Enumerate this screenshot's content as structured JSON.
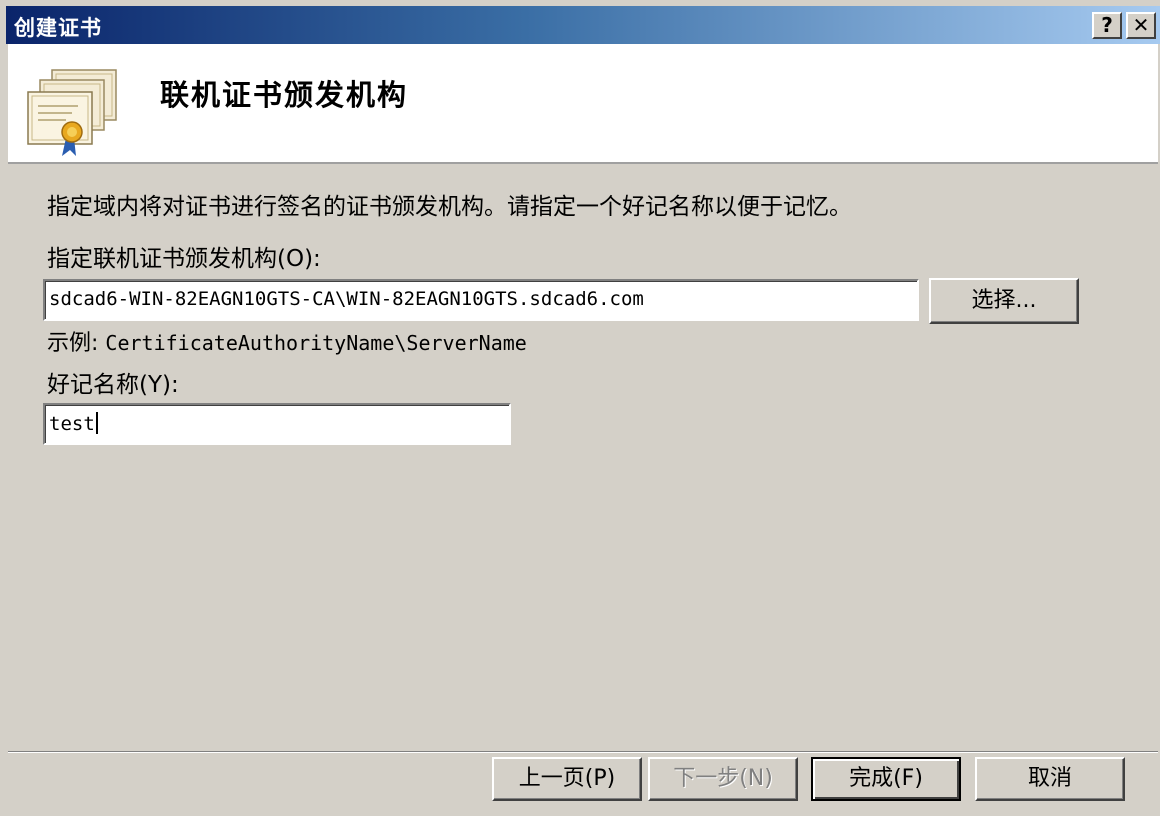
{
  "window": {
    "title": "创建证书",
    "help_label": "?",
    "close_label": "✕"
  },
  "header": {
    "title": "联机证书颁发机构",
    "icon": "certificate-icon"
  },
  "body": {
    "description": "指定域内将对证书进行签名的证书颁发机构。请指定一个好记名称以便于记忆。",
    "ca_label": "指定联机证书颁发机构(O):",
    "ca_value": "sdcad6-WIN-82EAGN10GTS-CA\\WIN-82EAGN10GTS.sdcad6.com",
    "select_label": "选择...",
    "example_prefix": "示例: ",
    "example_value": "CertificateAuthorityName\\ServerName",
    "nickname_label": "好记名称(Y):",
    "nickname_value": "test"
  },
  "footer": {
    "prev_label": "上一页(P)",
    "next_label": "下一步(N)",
    "finish_label": "完成(F)",
    "cancel_label": "取消"
  },
  "colors": {
    "titlebar_start": "#0a246a",
    "titlebar_end": "#a6caf0",
    "dialog_bg": "#d4d0c8"
  }
}
